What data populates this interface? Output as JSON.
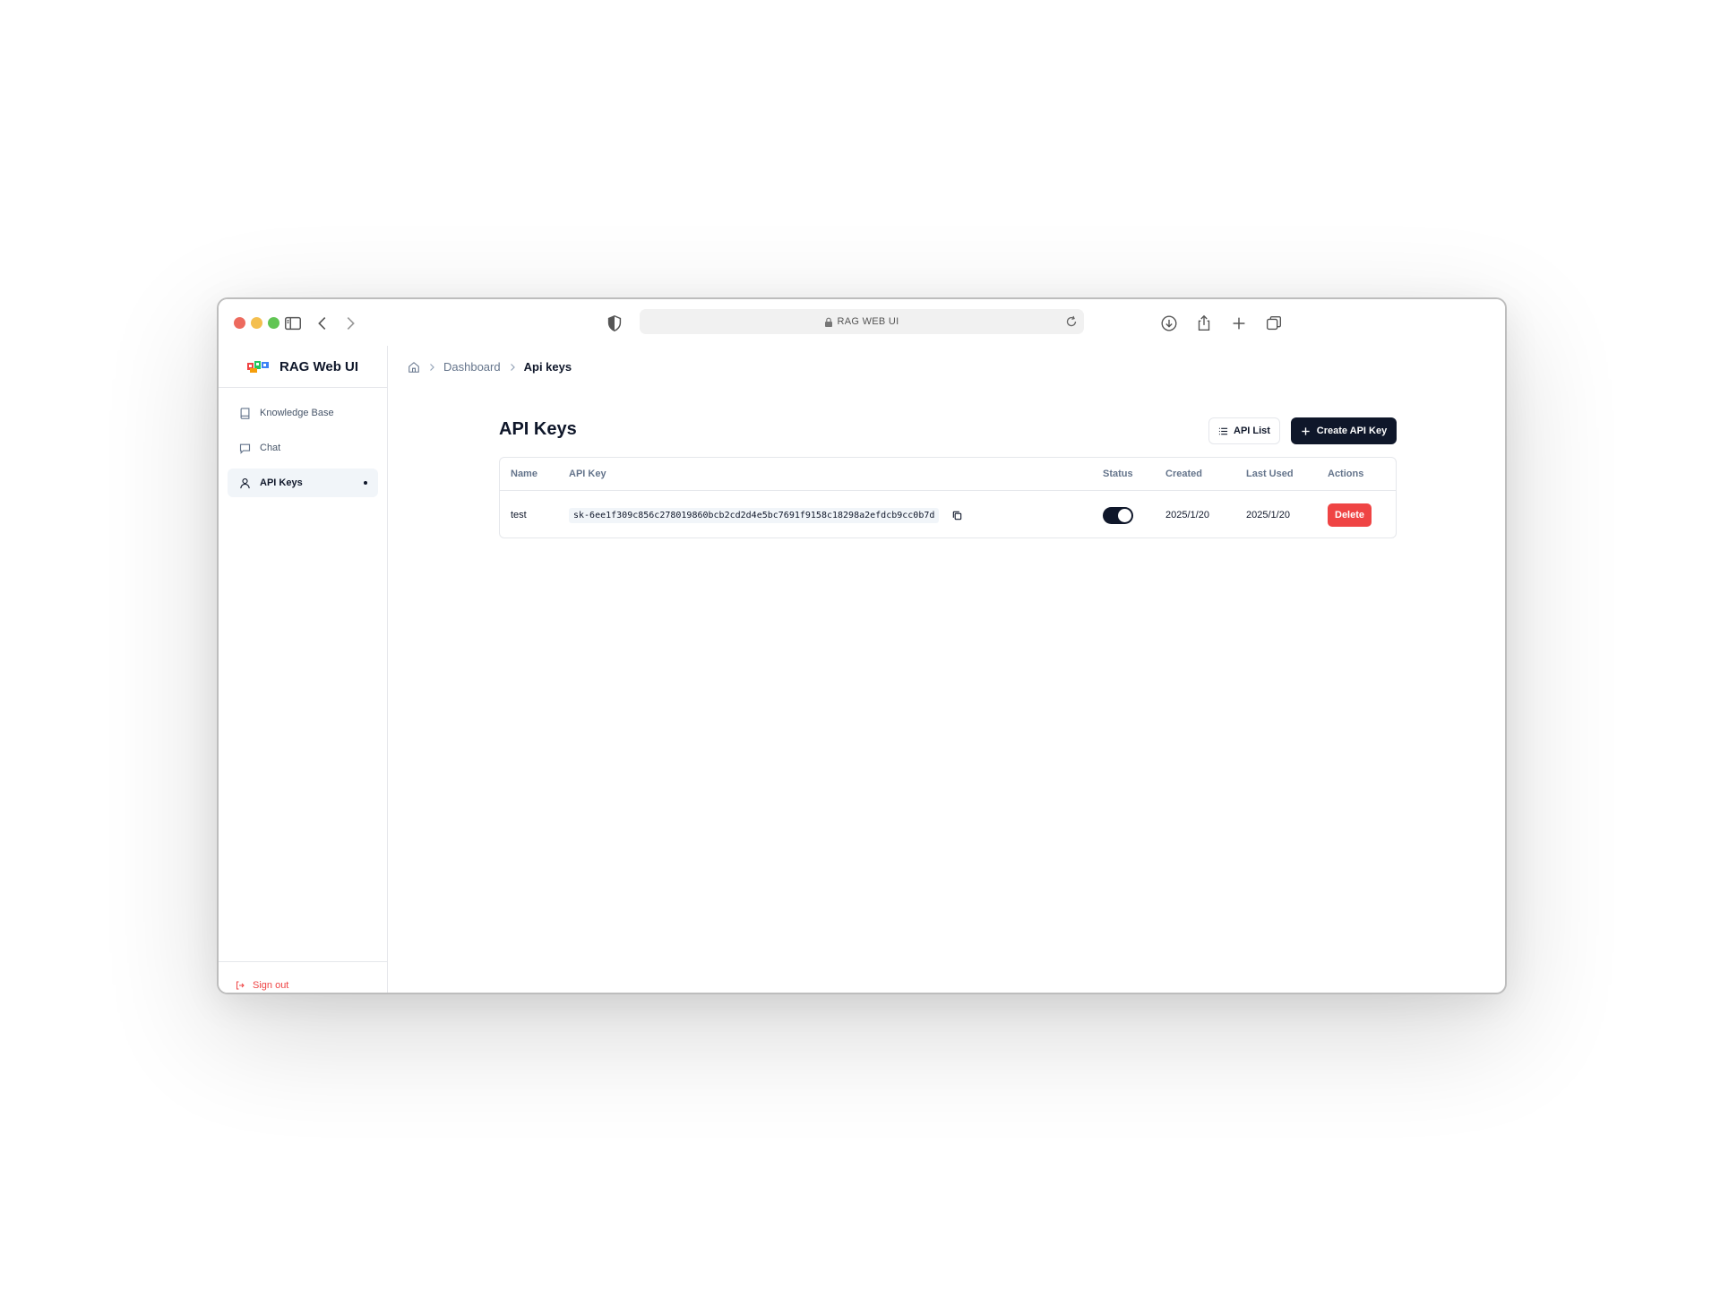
{
  "browser": {
    "url_text": "RAG WEB UI"
  },
  "sidebar": {
    "brand": "RAG Web UI",
    "items": [
      {
        "label": "Knowledge Base",
        "icon": "book-icon"
      },
      {
        "label": "Chat",
        "icon": "message-square-icon"
      },
      {
        "label": "API Keys",
        "icon": "user-icon",
        "active": true
      }
    ],
    "sign_out": "Sign out"
  },
  "breadcrumb": {
    "items": [
      "Dashboard",
      "Api keys"
    ]
  },
  "page": {
    "title": "API Keys",
    "list_button": "API List",
    "create_button": "Create API Key"
  },
  "table": {
    "columns": [
      "Name",
      "API Key",
      "Status",
      "Created",
      "Last Used",
      "Actions"
    ],
    "rows": [
      {
        "name": "test",
        "api_key": "sk-6ee1f309c856c278019860bcb2cd2d4e5bc7691f9158c18298a2efdcb9cc0b7d",
        "status_enabled": true,
        "created": "2025/1/20",
        "last_used": "2025/1/20",
        "action": "Delete"
      }
    ]
  },
  "colors": {
    "primary": "#0f172a",
    "danger": "#ef4444",
    "muted_text": "#64748b"
  }
}
